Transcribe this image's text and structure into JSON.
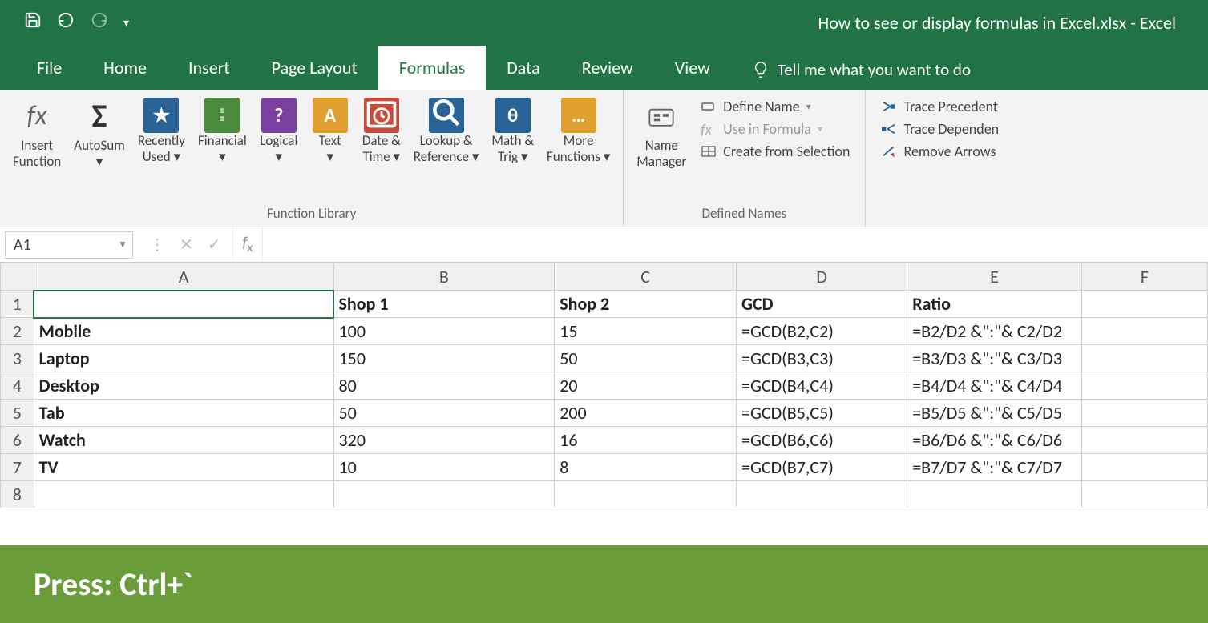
{
  "title": "How to see or display formulas in Excel.xlsx  -  Excel",
  "tabs": {
    "file": "File",
    "home": "Home",
    "insert": "Insert",
    "pagelayout": "Page Layout",
    "formulas": "Formulas",
    "data": "Data",
    "review": "Review",
    "view": "View"
  },
  "tellme": "Tell me what you want to do",
  "ribbon": {
    "insertFunction": "Insert\nFunction",
    "autosum": "AutoSum",
    "recentlyUsed": "Recently\nUsed",
    "financial": "Financial",
    "logical": "Logical",
    "text": "Text",
    "dateTime": "Date &\nTime",
    "lookup": "Lookup &\nReference",
    "math": "Math &\nTrig",
    "more": "More\nFunctions",
    "group1": "Function Library",
    "nameMgr": "Name\nManager",
    "defineName": "Define Name",
    "useInFormula": "Use in Formula",
    "createSel": "Create from Selection",
    "group2": "Defined Names",
    "tracePrec": "Trace Precedent",
    "traceDep": "Trace Dependen",
    "removeArr": "Remove Arrows"
  },
  "namebox": "A1",
  "columns": [
    "A",
    "B",
    "C",
    "D",
    "E",
    "F"
  ],
  "rows": [
    {
      "n": "1",
      "A": "",
      "B": "Shop 1",
      "C": "Shop 2",
      "D": "GCD",
      "E": "Ratio",
      "bold": true
    },
    {
      "n": "2",
      "A": "Mobile",
      "B": "100",
      "C": "15",
      "D": "=GCD(B2,C2)",
      "E": "=B2/D2 &\":\"& C2/D2"
    },
    {
      "n": "3",
      "A": "Laptop",
      "B": "150",
      "C": "50",
      "D": "=GCD(B3,C3)",
      "E": "=B3/D3 &\":\"& C3/D3"
    },
    {
      "n": "4",
      "A": "Desktop",
      "B": "80",
      "C": "20",
      "D": "=GCD(B4,C4)",
      "E": "=B4/D4 &\":\"& C4/D4"
    },
    {
      "n": "5",
      "A": "Tab",
      "B": "50",
      "C": "200",
      "D": "=GCD(B5,C5)",
      "E": "=B5/D5 &\":\"& C5/D5"
    },
    {
      "n": "6",
      "A": "Watch",
      "B": "320",
      "C": "16",
      "D": "=GCD(B6,C6)",
      "E": "=B6/D6 &\":\"& C6/D6"
    },
    {
      "n": "7",
      "A": "TV",
      "B": "10",
      "C": "8",
      "D": "=GCD(B7,C7)",
      "E": "=B7/D7 &\":\"& C7/D7"
    },
    {
      "n": "8",
      "A": "",
      "B": "",
      "C": "",
      "D": "",
      "E": ""
    }
  ],
  "selectedCell": "A1",
  "hint": "Press: Ctrl+`"
}
